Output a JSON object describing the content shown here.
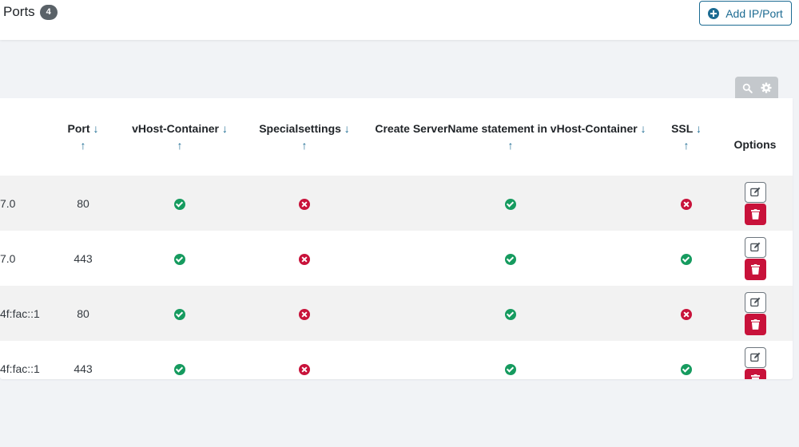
{
  "header": {
    "title": "Ports",
    "count": "4",
    "add_button_label": "Add IP/Port"
  },
  "table": {
    "columns": [
      {
        "label": "Port",
        "sort": "↓",
        "sort2": "↑"
      },
      {
        "label": "vHost-Container",
        "sort": "↓",
        "sort2": "↑"
      },
      {
        "label": "Specialsettings",
        "sort": "↓",
        "sort2": "↑"
      },
      {
        "label": "Create ServerName statement in vHost-Container",
        "sort": "↓",
        "sort2": "↑"
      },
      {
        "label": "SSL",
        "sort": "↓",
        "sort2": "↑"
      },
      {
        "label": "Options"
      }
    ],
    "rows": [
      {
        "address": "7.0",
        "port": "80",
        "vhost": "yes",
        "special": "no",
        "servername": "yes",
        "ssl": "no"
      },
      {
        "address": "7.0",
        "port": "443",
        "vhost": "yes",
        "special": "no",
        "servername": "yes",
        "ssl": "yes"
      },
      {
        "address": "4f:fac::1",
        "port": "80",
        "vhost": "yes",
        "special": "no",
        "servername": "yes",
        "ssl": "no"
      },
      {
        "address": "4f:fac::1",
        "port": "443",
        "vhost": "yes",
        "special": "no",
        "servername": "yes",
        "ssl": "yes"
      }
    ]
  },
  "icons": {
    "add": "plus-circle-icon",
    "search": "search-icon",
    "settings": "gear-icon",
    "edit": "edit-icon",
    "delete": "trash-icon",
    "yes": "check-circle-icon",
    "no": "times-circle-icon"
  },
  "colors": {
    "accent": "#1c6b92",
    "success": "#169b5f",
    "danger": "#c8123a",
    "badge": "#5a6268"
  }
}
